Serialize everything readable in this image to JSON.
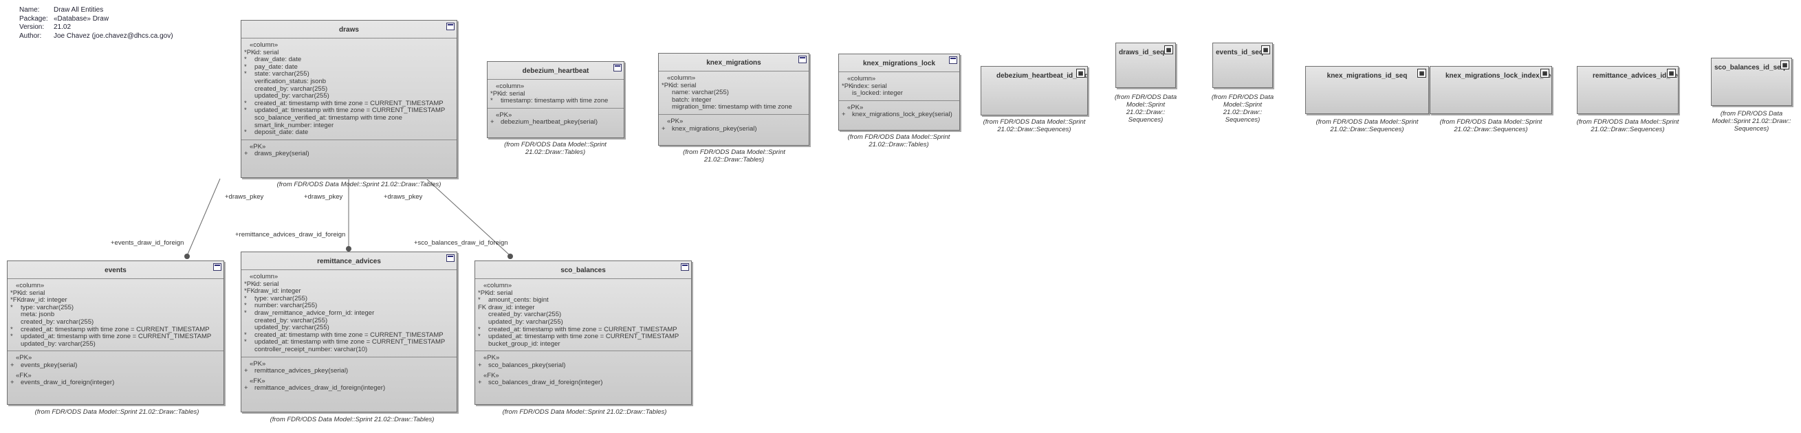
{
  "meta": [
    {
      "key": "Name:",
      "value": "Draw All Entities"
    },
    {
      "key": "Package:",
      "value": "«Database» Draw"
    },
    {
      "key": "Version:",
      "value": "21.02"
    },
    {
      "key": "Author:",
      "value": "Joe Chavez (joe.chavez@dhcs.ca.gov)"
    }
  ],
  "entities": {
    "draws": {
      "title": "draws",
      "sections": [
        {
          "header": "«column»",
          "rows": [
            [
              "*PK",
              "id: serial"
            ],
            [
              "*",
              "draw_date: date"
            ],
            [
              "*",
              "pay_date: date"
            ],
            [
              "*",
              "state: varchar(255)"
            ],
            [
              "",
              "verification_status: jsonb"
            ],
            [
              "",
              "created_by: varchar(255)"
            ],
            [
              "",
              "updated_by: varchar(255)"
            ],
            [
              "*",
              "created_at: timestamp with time zone = CURRENT_TIMESTAMP"
            ],
            [
              "*",
              "updated_at: timestamp with time zone = CURRENT_TIMESTAMP"
            ],
            [
              "",
              "sco_balance_verified_at: timestamp with time zone"
            ],
            [
              "",
              "smart_link_number: integer"
            ],
            [
              "*",
              "deposit_date: date"
            ]
          ]
        },
        {
          "header": "«PK»",
          "rows": [
            [
              "+",
              "draws_pkey(serial)"
            ]
          ]
        }
      ],
      "from": "(from FDR/ODS Data Model::Sprint 21.02::Draw::Tables)"
    },
    "debezium_heartbeat": {
      "title": "debezium_heartbeat",
      "sections": [
        {
          "header": "«column»",
          "rows": [
            [
              "*PK",
              "id: serial"
            ],
            [
              "*",
              "timestamp: timestamp with time zone"
            ]
          ]
        },
        {
          "header": "«PK»",
          "rows": [
            [
              "+",
              "debezium_heartbeat_pkey(serial)"
            ]
          ]
        }
      ],
      "from": "(from FDR/ODS Data Model::Sprint 21.02::Draw::Tables)"
    },
    "knex_migrations": {
      "title": "knex_migrations",
      "sections": [
        {
          "header": "«column»",
          "rows": [
            [
              "*PK",
              "id: serial"
            ],
            [
              "",
              "name: varchar(255)"
            ],
            [
              "",
              "batch: integer"
            ],
            [
              "",
              "migration_time: timestamp with time zone"
            ]
          ]
        },
        {
          "header": "«PK»",
          "rows": [
            [
              "+",
              "knex_migrations_pkey(serial)"
            ]
          ]
        }
      ],
      "from": "(from FDR/ODS Data Model::Sprint 21.02::Draw::Tables)"
    },
    "knex_migrations_lock": {
      "title": "knex_migrations_lock",
      "sections": [
        {
          "header": "«column»",
          "rows": [
            [
              "*PK",
              "index: serial"
            ],
            [
              "",
              "is_locked: integer"
            ]
          ]
        },
        {
          "header": "«PK»",
          "rows": [
            [
              "+",
              "knex_migrations_lock_pkey(serial)"
            ]
          ]
        }
      ],
      "from": "(from FDR/ODS Data Model::Sprint 21.02::Draw::Tables)"
    },
    "events": {
      "title": "events",
      "sections": [
        {
          "header": "«column»",
          "rows": [
            [
              "*PK",
              "id: serial"
            ],
            [
              "*FK",
              "draw_id: integer"
            ],
            [
              "*",
              "type: varchar(255)"
            ],
            [
              "",
              "meta: jsonb"
            ],
            [
              "",
              "created_by: varchar(255)"
            ],
            [
              "*",
              "created_at: timestamp with time zone = CURRENT_TIMESTAMP"
            ],
            [
              "*",
              "updated_at: timestamp with time zone = CURRENT_TIMESTAMP"
            ],
            [
              "",
              "updated_by: varchar(255)"
            ]
          ]
        },
        {
          "header": "«PK»",
          "rows": [
            [
              "+",
              "events_pkey(serial)"
            ]
          ]
        },
        {
          "header": "«FK»",
          "rows": [
            [
              "+",
              "events_draw_id_foreign(integer)"
            ]
          ]
        }
      ],
      "from": "(from FDR/ODS Data Model::Sprint 21.02::Draw::Tables)"
    },
    "remittance_advices": {
      "title": "remittance_advices",
      "sections": [
        {
          "header": "«column»",
          "rows": [
            [
              "*PK",
              "id: serial"
            ],
            [
              "*FK",
              "draw_id: integer"
            ],
            [
              "*",
              "type: varchar(255)"
            ],
            [
              "*",
              "number: varchar(255)"
            ],
            [
              "*",
              "draw_remittance_advice_form_id: integer"
            ],
            [
              "",
              "created_by: varchar(255)"
            ],
            [
              "",
              "updated_by: varchar(255)"
            ],
            [
              "*",
              "created_at: timestamp with time zone = CURRENT_TIMESTAMP"
            ],
            [
              "*",
              "updated_at: timestamp with time zone = CURRENT_TIMESTAMP"
            ],
            [
              "",
              "controller_receipt_number: varchar(10)"
            ]
          ]
        },
        {
          "header": "«PK»",
          "rows": [
            [
              "+",
              "remittance_advices_pkey(serial)"
            ]
          ]
        },
        {
          "header": "«FK»",
          "rows": [
            [
              "+",
              "remittance_advices_draw_id_foreign(integer)"
            ]
          ]
        }
      ],
      "from": "(from FDR/ODS Data Model::Sprint 21.02::Draw::Tables)"
    },
    "sco_balances": {
      "title": "sco_balances",
      "sections": [
        {
          "header": "«column»",
          "rows": [
            [
              "*PK",
              "id: serial"
            ],
            [
              "*",
              "amount_cents: bigint"
            ],
            [
              "FK",
              "draw_id: integer"
            ],
            [
              "",
              "created_by: varchar(255)"
            ],
            [
              "",
              "updated_by: varchar(255)"
            ],
            [
              "*",
              "created_at: timestamp with time zone = CURRENT_TIMESTAMP"
            ],
            [
              "*",
              "updated_at: timestamp with time zone = CURRENT_TIMESTAMP"
            ],
            [
              "",
              "bucket_group_id: integer"
            ]
          ]
        },
        {
          "header": "«PK»",
          "rows": [
            [
              "+",
              "sco_balances_pkey(serial)"
            ]
          ]
        },
        {
          "header": "«FK»",
          "rows": [
            [
              "+",
              "sco_balances_draw_id_foreign(integer)"
            ]
          ]
        }
      ],
      "from": "(from FDR/ODS Data Model::Sprint 21.02::Draw::Tables)"
    }
  },
  "sequences": [
    {
      "title": "debezium_heartbeat_id_seq",
      "from": "(from FDR/ODS Data Model::Sprint 21.02::Draw::Sequences)"
    },
    {
      "title": "draws_id_seq",
      "from": "(from FDR/ODS Data Model::Sprint 21.02::Draw:: Sequences)"
    },
    {
      "title": "events_id_seq",
      "from": "(from FDR/ODS Data Model::Sprint 21.02::Draw:: Sequences)"
    },
    {
      "title": "knex_migrations_id_seq",
      "from": "(from FDR/ODS Data Model::Sprint 21.02::Draw::Sequences)"
    },
    {
      "title": "knex_migrations_lock_index_seq",
      "from": "(from FDR/ODS Data Model::Sprint 21.02::Draw::Sequences)"
    },
    {
      "title": "remittance_advices_id_seq",
      "from": "(from FDR/ODS Data Model::Sprint 21.02::Draw::Sequences)"
    },
    {
      "title": "sco_balances_id_seq",
      "from": "(from FDR/ODS Data Model::Sprint 21.02::Draw:: Sequences)"
    }
  ],
  "relationships": [
    {
      "source_label": "+draws_pkey",
      "target_label": "+events_draw_id_foreign"
    },
    {
      "source_label": "+draws_pkey",
      "target_label": "+remittance_advices_draw_id_foreign"
    },
    {
      "source_label": "+draws_pkey",
      "target_label": "+sco_balances_draw_id_foreign"
    }
  ]
}
